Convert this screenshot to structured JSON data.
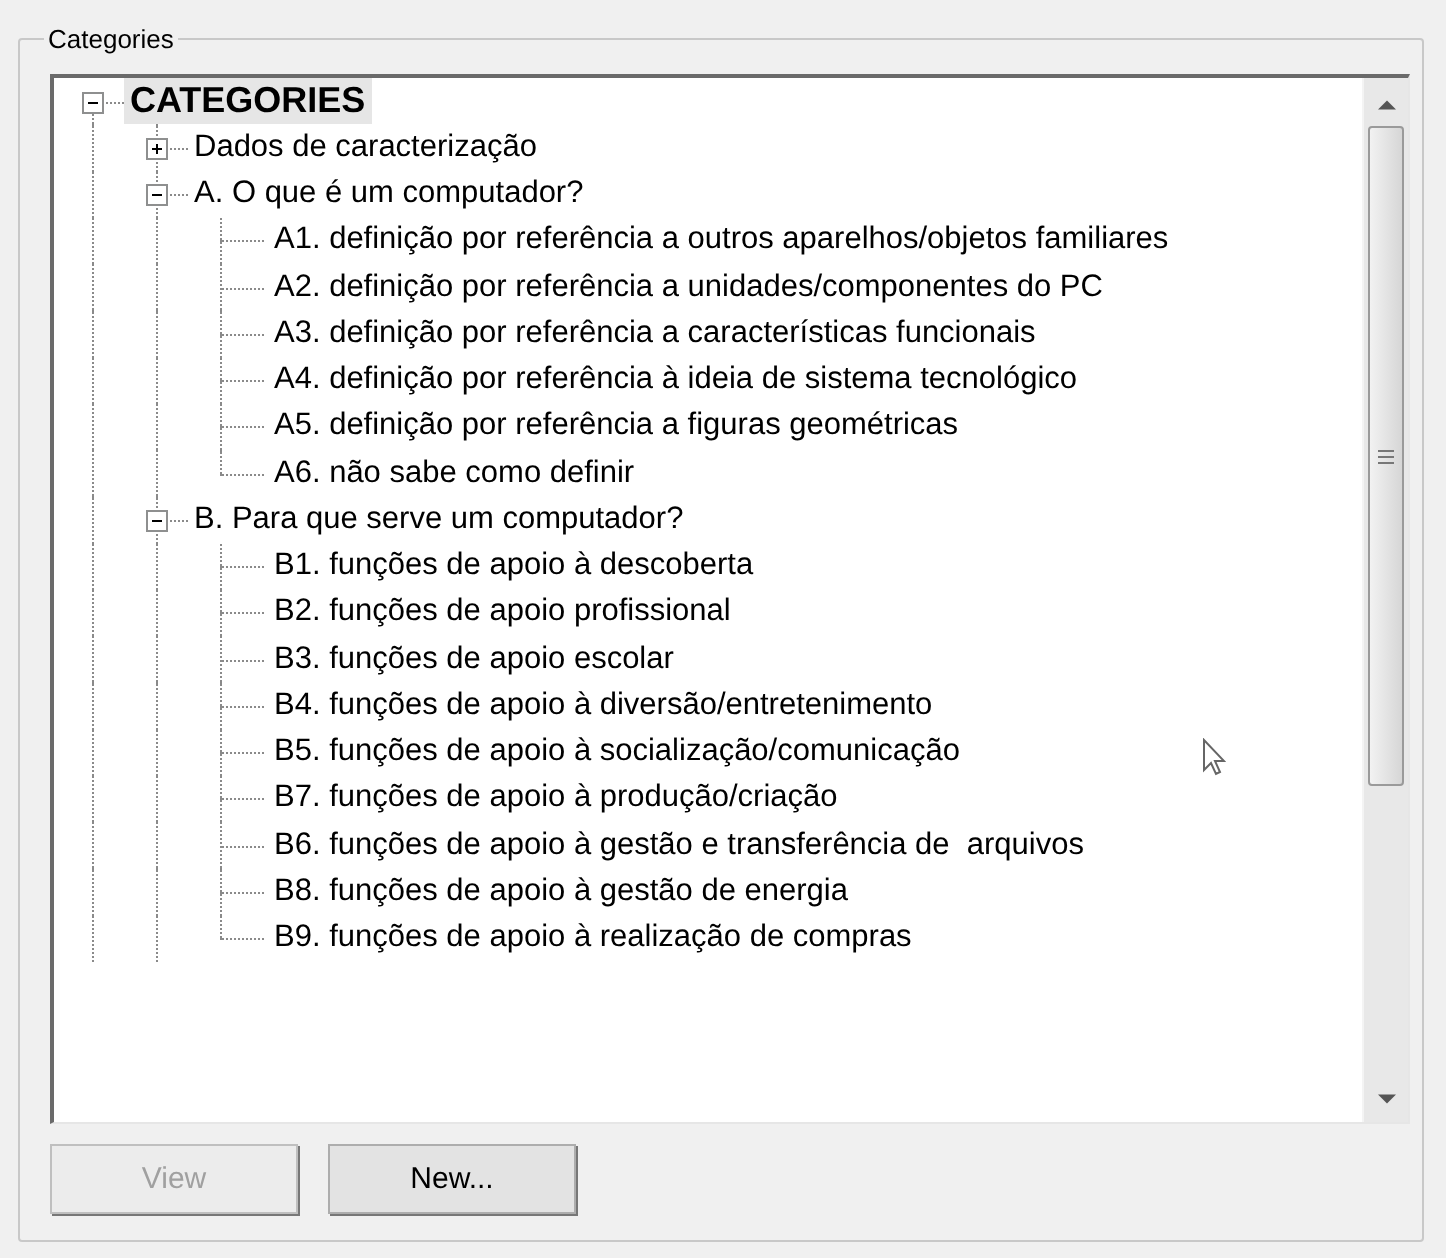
{
  "group": {
    "title": "Categories"
  },
  "tree": [
    {
      "label": "CATEGORIES",
      "selected": true,
      "expanded": true,
      "children": [
        {
          "label": "Dados de caracterização",
          "selected": false,
          "expanded": false
        },
        {
          "label": "A. O que é um computador?",
          "selected": false,
          "expanded": true,
          "children": [
            {
              "label": "A1. definição por referência a outros aparelhos/objetos familiares",
              "selected": false
            },
            {
              "label": "A2. definição por referência a unidades/componentes do PC",
              "selected": false
            },
            {
              "label": "A3. definição por referência a características funcionais",
              "selected": false
            },
            {
              "label": "A4. definição por referência à ideia de sistema tecnológico",
              "selected": false
            },
            {
              "label": "A5. definição por referência a figuras geométricas",
              "selected": false
            },
            {
              "label": "A6. não sabe como definir",
              "selected": false
            }
          ]
        },
        {
          "label": "B. Para que serve um computador?",
          "selected": false,
          "expanded": true,
          "children": [
            {
              "label": "B1. funções de apoio à descoberta",
              "selected": false
            },
            {
              "label": "B2. funções de apoio profissional",
              "selected": false
            },
            {
              "label": "B3. funções de apoio escolar",
              "selected": false
            },
            {
              "label": "B4. funções de apoio à diversão/entretenimento",
              "selected": false
            },
            {
              "label": "B5. funções de apoio à socialização/comunicação",
              "selected": false
            },
            {
              "label": "B7. funções de apoio à produção/criação",
              "selected": false
            },
            {
              "label": "B6. funções de apoio à gestão e transferência de  arquivos",
              "selected": false
            },
            {
              "label": "B8. funções de apoio à gestão de energia",
              "selected": false
            },
            {
              "label": "B9. funções de apoio à realização de compras",
              "selected": false
            }
          ]
        }
      ]
    }
  ],
  "buttons": [
    {
      "label": "View",
      "disabled": true
    },
    {
      "label": "New...",
      "disabled": false
    }
  ]
}
